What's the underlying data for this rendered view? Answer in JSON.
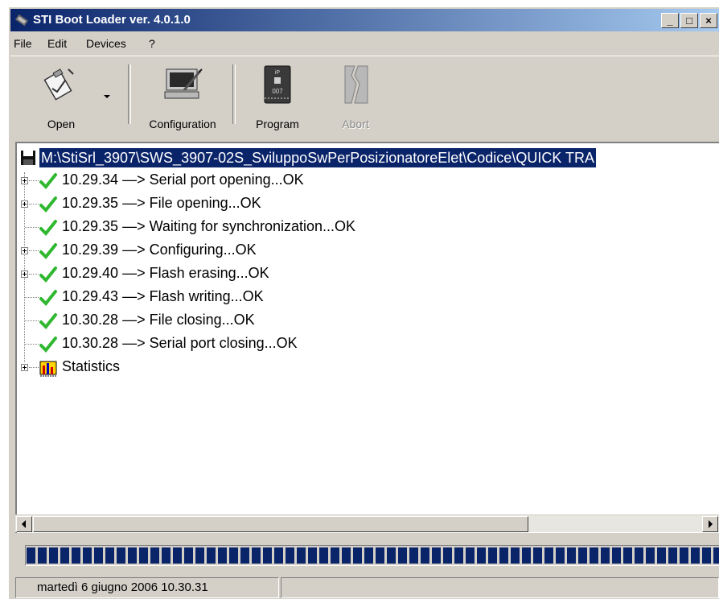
{
  "window": {
    "title": "STI Boot Loader ver. 4.0.1.0",
    "controls": {
      "minimize": "_",
      "maximize": "□",
      "close": "×"
    }
  },
  "menu": [
    "File",
    "Edit",
    "Devices",
    "?"
  ],
  "toolbar": {
    "open_label": "Open",
    "configuration_label": "Configuration",
    "program_label": "Program",
    "abort_label": "Abort",
    "chip_text_top": "iP",
    "chip_text_bottom": "007"
  },
  "tree": {
    "root_path": "M:\\StiSrl_3907\\SWS_3907-02S_SviluppoSwPerPosizionatoreElet\\Codice\\QUICK TRA",
    "items": [
      {
        "text": "10.29.34 —> Serial port opening...OK",
        "expandable": true
      },
      {
        "text": "10.29.35 —> File opening...OK",
        "expandable": true
      },
      {
        "text": "10.29.35 —> Waiting for synchronization...OK",
        "expandable": false
      },
      {
        "text": "10.29.39 —> Configuring...OK",
        "expandable": true
      },
      {
        "text": "10.29.40 —> Flash erasing...OK",
        "expandable": true
      },
      {
        "text": "10.29.43 —> Flash writing...OK",
        "expandable": false
      },
      {
        "text": "10.30.28 —> File closing...OK",
        "expandable": false
      },
      {
        "text": "10.30.28 —> Serial port closing...OK",
        "expandable": false
      }
    ],
    "statistics_label": "Statistics",
    "status_icon": "green-check-icon"
  },
  "progress": {
    "value": 1.0
  },
  "status": {
    "datetime": "martedì 6 giugno 2006 10.30.31"
  },
  "colors": {
    "selection": "#0a246a",
    "check": "#2fb82f",
    "face": "#d4d0c8"
  }
}
